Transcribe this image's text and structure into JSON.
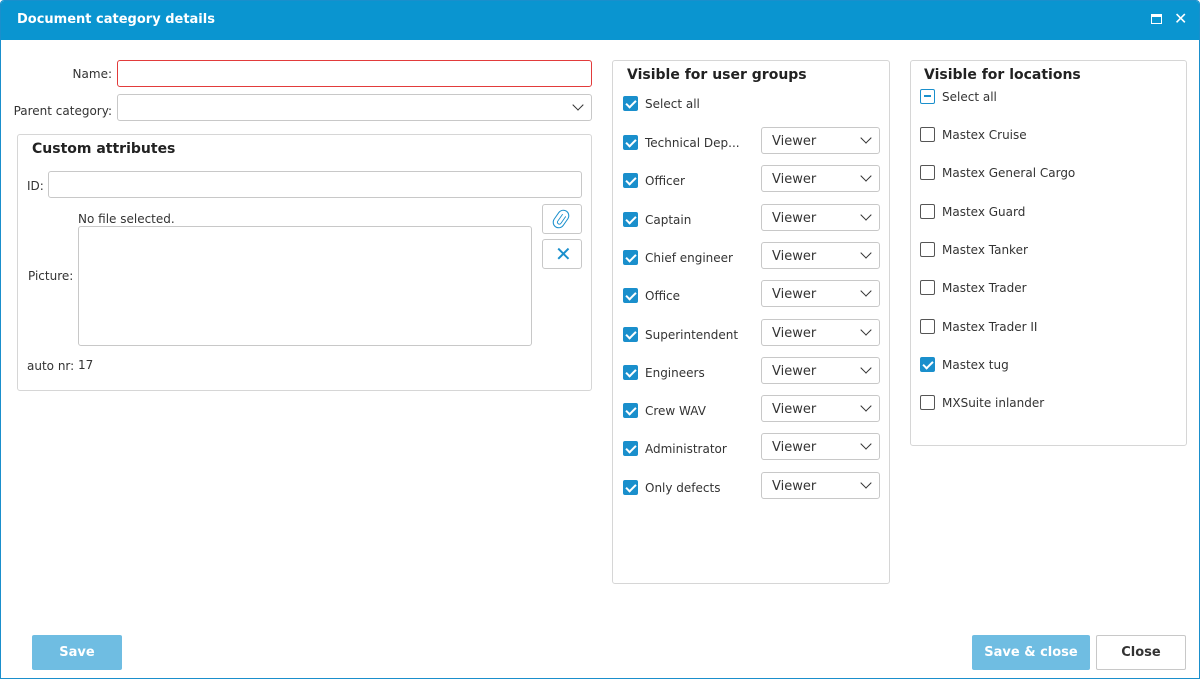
{
  "window": {
    "title": "Document category details",
    "maximize_icon": "maximize-icon",
    "close_icon": "close-icon"
  },
  "form": {
    "name_label": "Name:",
    "name_value": "",
    "parent_label": "Parent category:",
    "parent_value": ""
  },
  "custom_attributes": {
    "title": "Custom attributes",
    "id_label": "ID:",
    "id_value": "",
    "no_file_text": "No file selected.",
    "picture_label": "Picture:",
    "attach_icon": "paperclip-icon",
    "remove_icon": "close-icon",
    "remove_glyph": "✕",
    "auto_nr_label": "auto nr:",
    "auto_nr_value": "17"
  },
  "user_groups": {
    "title": "Visible for user groups",
    "select_all_label": "Select all",
    "select_all_state": "checked",
    "items": [
      {
        "label": "Technical Dep...",
        "checked": true,
        "role": "Viewer"
      },
      {
        "label": "Officer",
        "checked": true,
        "role": "Viewer"
      },
      {
        "label": "Captain",
        "checked": true,
        "role": "Viewer"
      },
      {
        "label": "Chief engineer",
        "checked": true,
        "role": "Viewer"
      },
      {
        "label": "Office",
        "checked": true,
        "role": "Viewer"
      },
      {
        "label": "Superintendent",
        "checked": true,
        "role": "Viewer"
      },
      {
        "label": "Engineers",
        "checked": true,
        "role": "Viewer"
      },
      {
        "label": "Crew WAV",
        "checked": true,
        "role": "Viewer"
      },
      {
        "label": "Administrator",
        "checked": true,
        "role": "Viewer"
      },
      {
        "label": "Only defects",
        "checked": true,
        "role": "Viewer"
      }
    ]
  },
  "locations": {
    "title": "Visible for locations",
    "select_all_label": "Select all",
    "select_all_state": "partial",
    "items": [
      {
        "label": "Mastex Cruise",
        "checked": false
      },
      {
        "label": "Mastex General Cargo",
        "checked": false
      },
      {
        "label": "Mastex Guard",
        "checked": false
      },
      {
        "label": "Mastex Tanker",
        "checked": false
      },
      {
        "label": "Mastex Trader",
        "checked": false
      },
      {
        "label": "Mastex Trader II",
        "checked": false
      },
      {
        "label": "Mastex tug",
        "checked": true
      },
      {
        "label": "MXSuite inlander",
        "checked": false
      }
    ]
  },
  "footer": {
    "save_label": "Save",
    "save_close_label": "Save & close",
    "close_label": "Close"
  },
  "colors": {
    "accent": "#0a95d0",
    "button_primary": "#6fbde2",
    "error_border": "#e23b3b"
  }
}
